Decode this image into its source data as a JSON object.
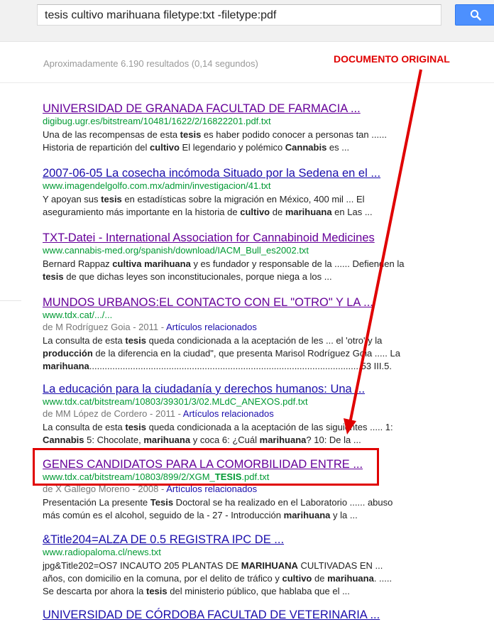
{
  "search": {
    "query": "tesis cultivo marihuana filetype:txt -filetype:pdf"
  },
  "stats": "Aproximadamente 6.190 resultados (0,14 segundos)",
  "annotation": "DOCUMENTO ORIGINAL",
  "colors": {
    "annotation_red": "#e00000",
    "url_green": "#009933",
    "visited_link": "#660099",
    "link_blue": "#1a0dab",
    "search_button_blue": "#4d90fe"
  },
  "results": [
    {
      "title": "UNIVERSIDAD DE GRANADA FACULTAD DE FARMACIA ...",
      "url": "digibug.ugr.es/bitstream/10481/1622/2/16822201.pdf.txt",
      "snippet": [
        [
          "Una de las recompensas de esta ",
          ""
        ],
        [
          "tesis",
          "b"
        ],
        [
          " es haber podido conocer a personas tan ......",
          ""
        ],
        [
          "\nHistoria de repartición del ",
          ""
        ],
        [
          "cultivo",
          "b"
        ],
        [
          " El legendario y polémico ",
          ""
        ],
        [
          "Cannabis",
          "b"
        ],
        [
          " es ...",
          ""
        ]
      ]
    },
    {
      "title": "2007-06-05 La cosecha incómoda Situado por la Sedena en el ...",
      "url": "www.imagendelgolfo.com.mx/admin/investigacion/41.txt",
      "snippet": [
        [
          "Y apoyan sus ",
          ""
        ],
        [
          "tesis",
          "b"
        ],
        [
          " en estadísticas sobre la migración en México, 400 mil ... El",
          ""
        ],
        [
          "\naseguramiento más importante en la historia de ",
          ""
        ],
        [
          "cultivo",
          "b"
        ],
        [
          " de ",
          ""
        ],
        [
          "marihuana",
          "b"
        ],
        [
          " en Las ...",
          ""
        ]
      ]
    },
    {
      "title": "TXT-Datei - International Association for Cannabinoid Medicines",
      "url": "www.cannabis-med.org/spanish/download/IACM_Bull_es2002.txt",
      "snippet": [
        [
          "Bernard Rappaz ",
          ""
        ],
        [
          "cultiva marihuana",
          "b"
        ],
        [
          " y es fundador y responsable de la ...... Defienden la",
          ""
        ],
        [
          "\n",
          ""
        ],
        [
          "tesis",
          "b"
        ],
        [
          " de que dichas leyes son inconstitucionales, porque niega a los ...",
          ""
        ]
      ]
    },
    {
      "title": "MUNDOS URBANOS:EL CONTACTO CON EL \"OTRO\" Y LA ...",
      "url": "www.tdx.cat/.../...",
      "author": "de M Rodríguez Goia",
      "year": "2011",
      "related": "Artículos relacionados",
      "snippet": [
        [
          "La consulta de esta ",
          ""
        ],
        [
          "tesis",
          "b"
        ],
        [
          " queda condicionada a la aceptación de les ... el 'otro' y la",
          ""
        ],
        [
          "\n",
          ""
        ],
        [
          "producción",
          "b"
        ],
        [
          " de la diferencia en la ciudad\", que presenta Marisol Rodríguez Goia ..... La",
          ""
        ],
        [
          "\n",
          ""
        ],
        [
          "marihuana",
          "b"
        ],
        [
          "..........................................................................................................53 III.5.",
          ""
        ]
      ]
    },
    {
      "title": "La educación para la ciudadanía y derechos humanos: Una ...",
      "url": "www.tdx.cat/bitstream/10803/39301/3/02.MLdC_ANEXOS.pdf.txt",
      "author": "de MM López de Cordero",
      "year": "2011",
      "related": "Artículos relacionados",
      "snippet": [
        [
          "La consulta de esta ",
          ""
        ],
        [
          "tesis",
          "b"
        ],
        [
          " queda condicionada a la aceptación de las siguientes ..... 1:",
          ""
        ],
        [
          "\n",
          ""
        ],
        [
          "Cannabis",
          "b"
        ],
        [
          " 5: Chocolate, ",
          ""
        ],
        [
          "marihuana",
          "b"
        ],
        [
          " y coca 6: ¿Cuál ",
          ""
        ],
        [
          "marihuana",
          "b"
        ],
        [
          "? 10: De la ...",
          ""
        ]
      ]
    },
    {
      "title": "GENES CANDIDATOS PARA LA COMORBILIDAD ENTRE ...",
      "url_parts": [
        "www.tdx.cat/bitstream/10803/899/2/XGM_",
        "TESIS",
        ".pdf.txt"
      ],
      "author": "de X Gallego Moreno",
      "year": "2008",
      "related": "Artículos relacionados",
      "snippet": [
        [
          "Presentación La presente ",
          ""
        ],
        [
          "Tesis",
          "b"
        ],
        [
          " Doctoral se ha realizado en el Laboratorio ...... abuso",
          ""
        ],
        [
          "\nmás común es el alcohol, seguido de la - 27 - Introducción ",
          ""
        ],
        [
          "marihuana",
          "b"
        ],
        [
          " y la ...",
          ""
        ]
      ]
    },
    {
      "title": "&Title204=ALZA DE 0.5 REGISTRA IPC DE ...",
      "url": "www.radiopaloma.cl/news.txt",
      "snippet": [
        [
          "jpg&Title202=OS7 INCAUTO 205 PLANTAS DE ",
          ""
        ],
        [
          "MARIHUANA",
          "b"
        ],
        [
          " CULTIVADAS EN ...",
          ""
        ],
        [
          "\naños, con domicilio en la comuna, por el delito de tráfico y ",
          ""
        ],
        [
          "cultivo",
          "b"
        ],
        [
          " de ",
          ""
        ],
        [
          "marihuana",
          "b"
        ],
        [
          ". .....",
          ""
        ],
        [
          "\nSe descarta por ahora la ",
          ""
        ],
        [
          "tesis",
          "b"
        ],
        [
          " del ministerio público, que hablaba que el ...",
          ""
        ]
      ]
    },
    {
      "title": "UNIVERSIDAD DE CÓRDOBA FACULTAD DE VETERINARIA ..."
    }
  ]
}
